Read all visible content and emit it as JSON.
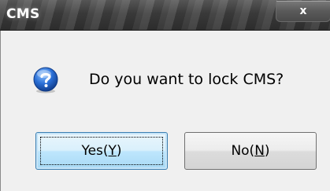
{
  "window": {
    "title": "CMS",
    "close_glyph": "x"
  },
  "dialog": {
    "icon": "question-icon",
    "message": "Do you want to lock CMS?"
  },
  "buttons": {
    "yes": {
      "label": "Yes(",
      "accel": "Y",
      "suffix": ")"
    },
    "no": {
      "label": "No(",
      "accel": "N",
      "suffix": ")"
    }
  },
  "colors": {
    "titlebar": "#3c3c3c",
    "client_bg": "#f0f0f0",
    "icon_blue": "#1f5fc4",
    "focus_border": "#3c7fb1"
  }
}
